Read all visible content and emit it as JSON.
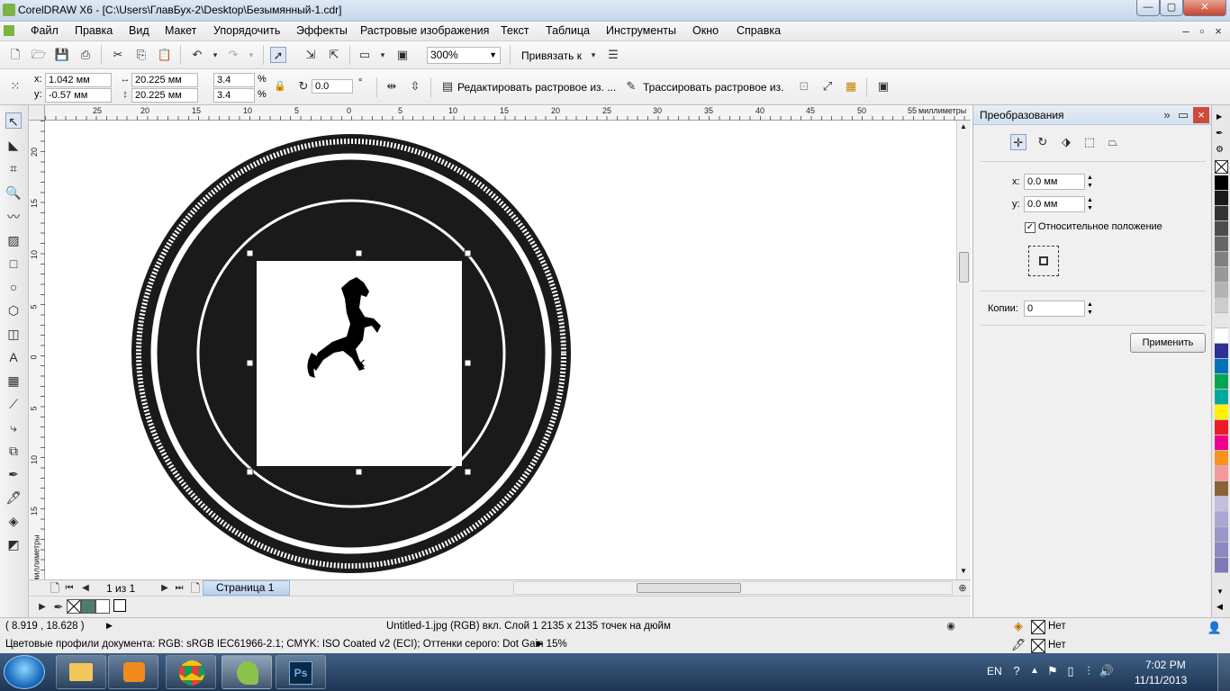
{
  "window": {
    "title": "CorelDRAW X6 - [C:\\Users\\ГлавБух-2\\Desktop\\Безымянный-1.cdr]",
    "min": "—",
    "max": "▢",
    "close": "✕"
  },
  "menu": [
    "Файл",
    "Правка",
    "Вид",
    "Макет",
    "Упорядочить",
    "Эффекты",
    "Растровые изображения",
    "Текст",
    "Таблица",
    "Инструменты",
    "Окно",
    "Справка"
  ],
  "std": {
    "zoom": "300%",
    "snap": "Привязать к"
  },
  "prop": {
    "x_label": "x:",
    "x": "1.042 мм",
    "y_label": "y:",
    "y": "-0.57 мм",
    "w": "20.225 мм",
    "h": "20.225 мм",
    "sx": "3.4",
    "sy": "3.4",
    "pct": "%",
    "pct2": "%",
    "angle": "0.0",
    "deg": "°",
    "edit_bitmap": "Редактировать растровое из. ...",
    "trace_bitmap": "Трассировать растровое из."
  },
  "ruler": {
    "h_ticks": [
      "25",
      "20",
      "15",
      "10",
      "5",
      "0",
      "5",
      "10",
      "15",
      "20",
      "25",
      "30",
      "35",
      "40",
      "45",
      "50",
      "55"
    ],
    "h_unit": "миллиметры",
    "v_ticks": [
      "20",
      "15",
      "10",
      "5",
      "0",
      "5",
      "10",
      "15"
    ],
    "v_unit": "миллиметры"
  },
  "pages": {
    "count": "1 из 1",
    "tab": "Страница 1"
  },
  "docker": {
    "title": "Преобразования",
    "x_label": "x:",
    "x": "0.0 мм",
    "y_label": "y:",
    "y": "0.0 мм",
    "relative": "Относительное положение",
    "copies_label": "Копии:",
    "copies": "0",
    "apply": "Применить"
  },
  "palette": [
    "#000000",
    "#1a1a1a",
    "#333333",
    "#4d4d4d",
    "#666666",
    "#808080",
    "#999999",
    "#b3b3b3",
    "#cccccc",
    "#e6e6e6",
    "#ffffff",
    "#2e3192",
    "#0072bc",
    "#00a651",
    "#00a99d",
    "#fff200",
    "#ed1c24",
    "#ec008c",
    "#f7941d",
    "#f5989d",
    "#8c6239",
    "#c4bfdf",
    "#aba7d3",
    "#9c97c9",
    "#8d88bf",
    "#7f79b5"
  ],
  "status": {
    "coords": "( 8.919 , 18.628 )",
    "info": "Untitled-1.jpg (RGB) вкл. Слой 1 2135 x 2135 точек на дюйм",
    "profiles": "Цветовые профили документа: RGB: sRGB IEC61966-2.1; CMYK: ISO Coated v2 (ECI); Оттенки серого: Dot Gain 15%",
    "fill": "Нет",
    "outline": "Нет"
  },
  "taskbar": {
    "lang": "EN",
    "time": "7:02 PM",
    "date": "11/11/2013"
  }
}
